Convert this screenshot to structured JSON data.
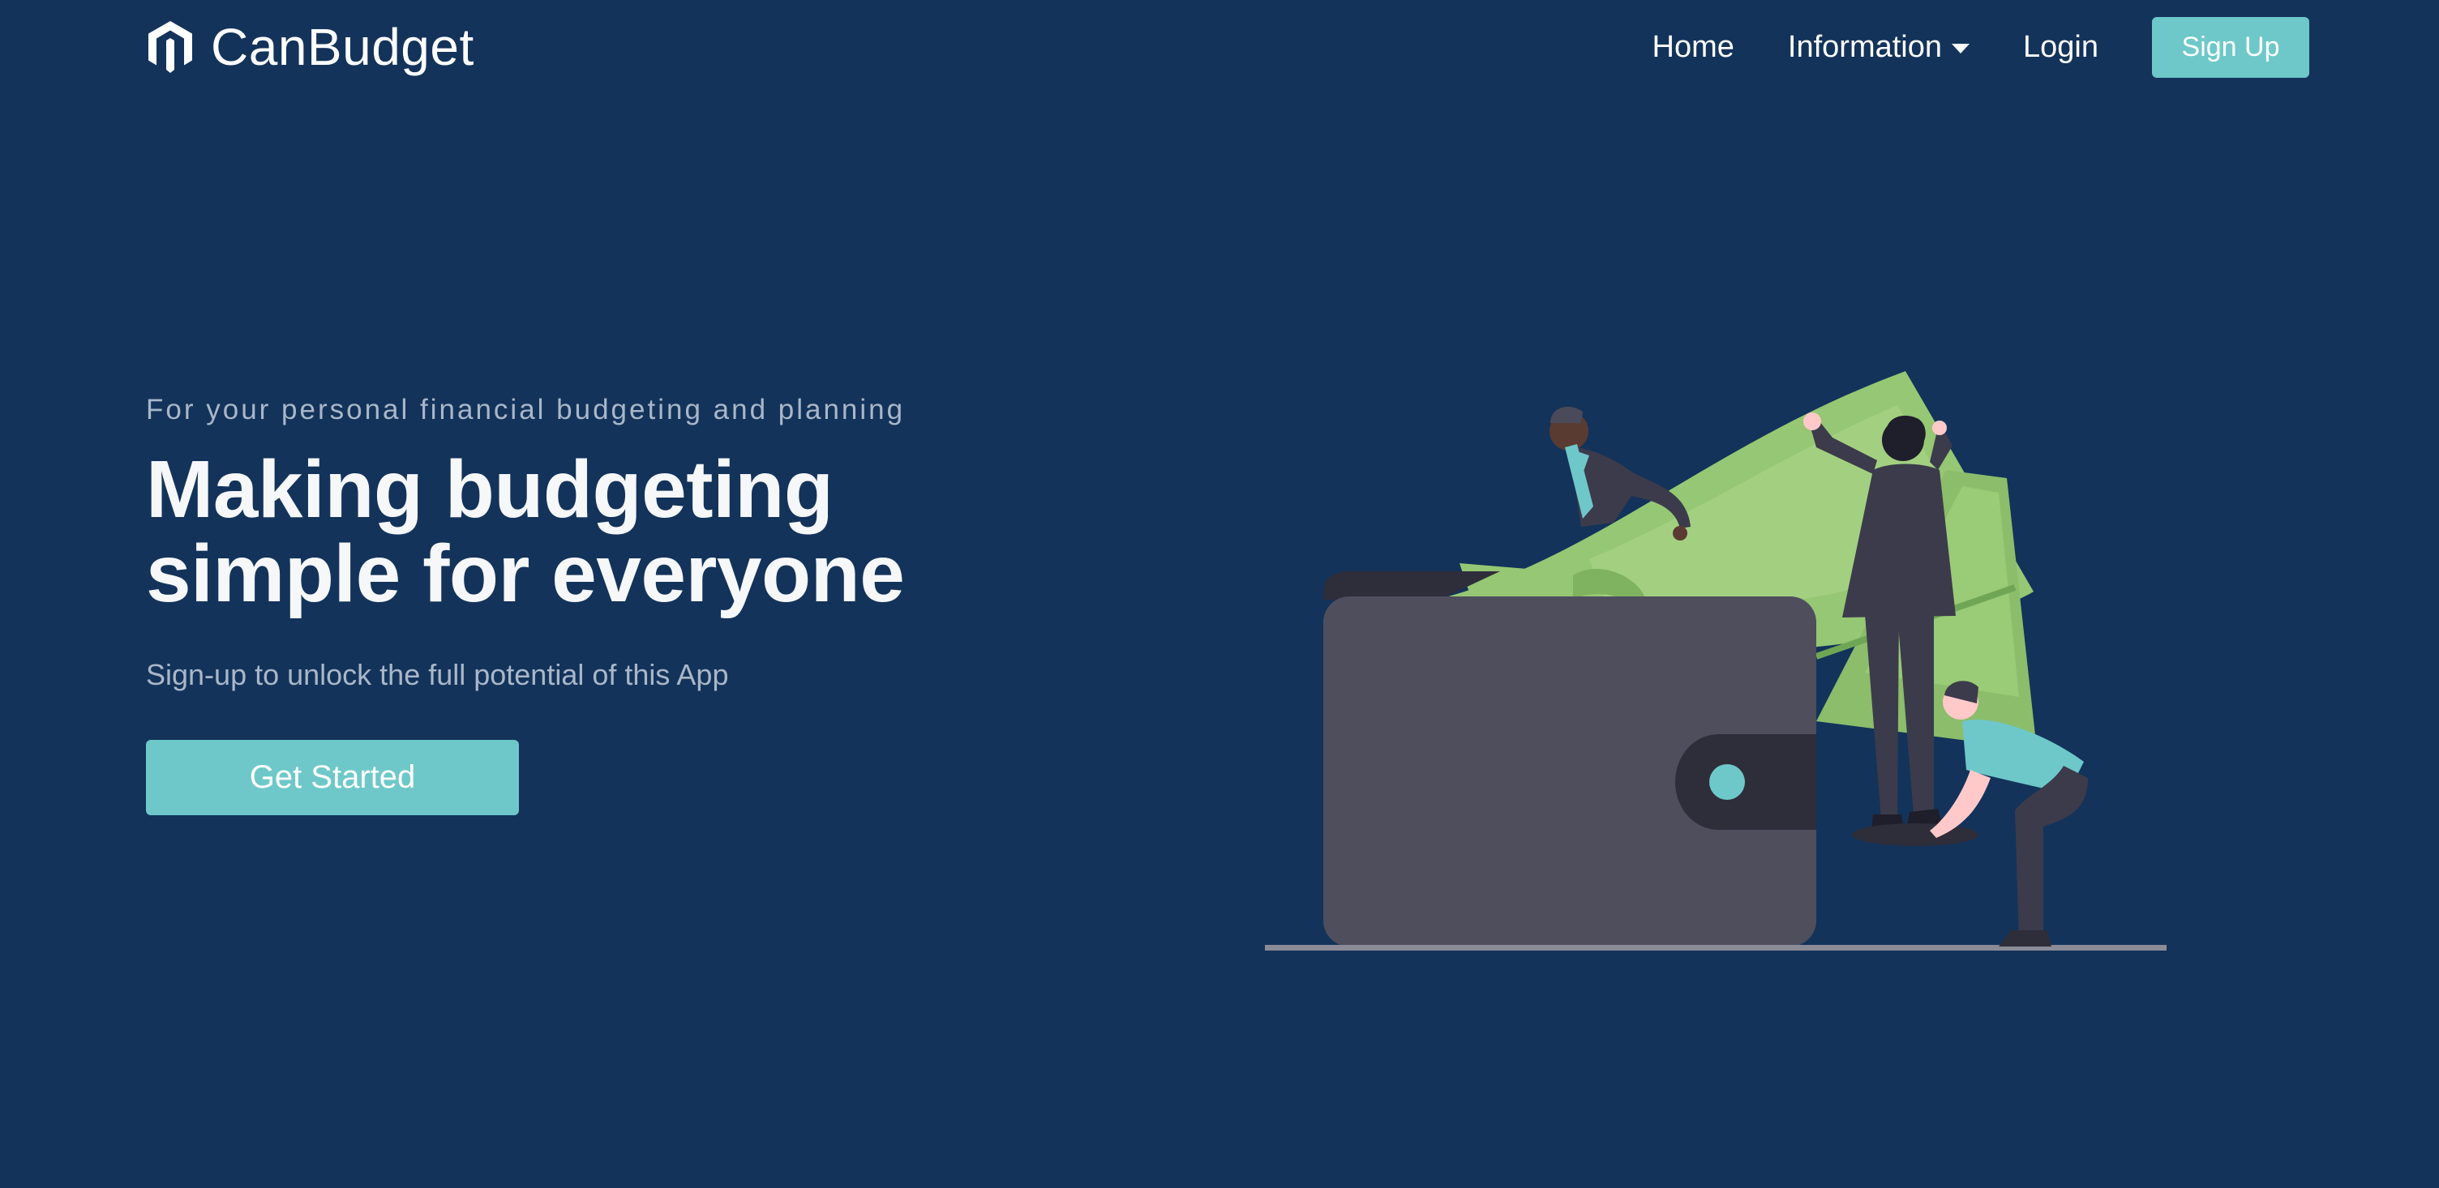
{
  "nav": {
    "brand_name": "CanBudget",
    "brand_icon": "magento-style-logo-icon",
    "links": {
      "home": "Home",
      "information": "Information",
      "login": "Login"
    },
    "signup_label": "Sign Up"
  },
  "hero": {
    "tagline": "For your personal financial budgeting and planning",
    "headline_line1": "Making budgeting",
    "headline_line2": "simple for everyone",
    "subtext": "Sign-up to unlock the full potential of this App",
    "cta_label": "Get Started",
    "illustration": "people-with-wallet-and-money-illustration"
  },
  "colors": {
    "background": "#13335a",
    "accent": "#6ec8c9",
    "muted_text": "#a9b7c9",
    "wallet": "#4f4e5d",
    "money": "#96c774"
  }
}
